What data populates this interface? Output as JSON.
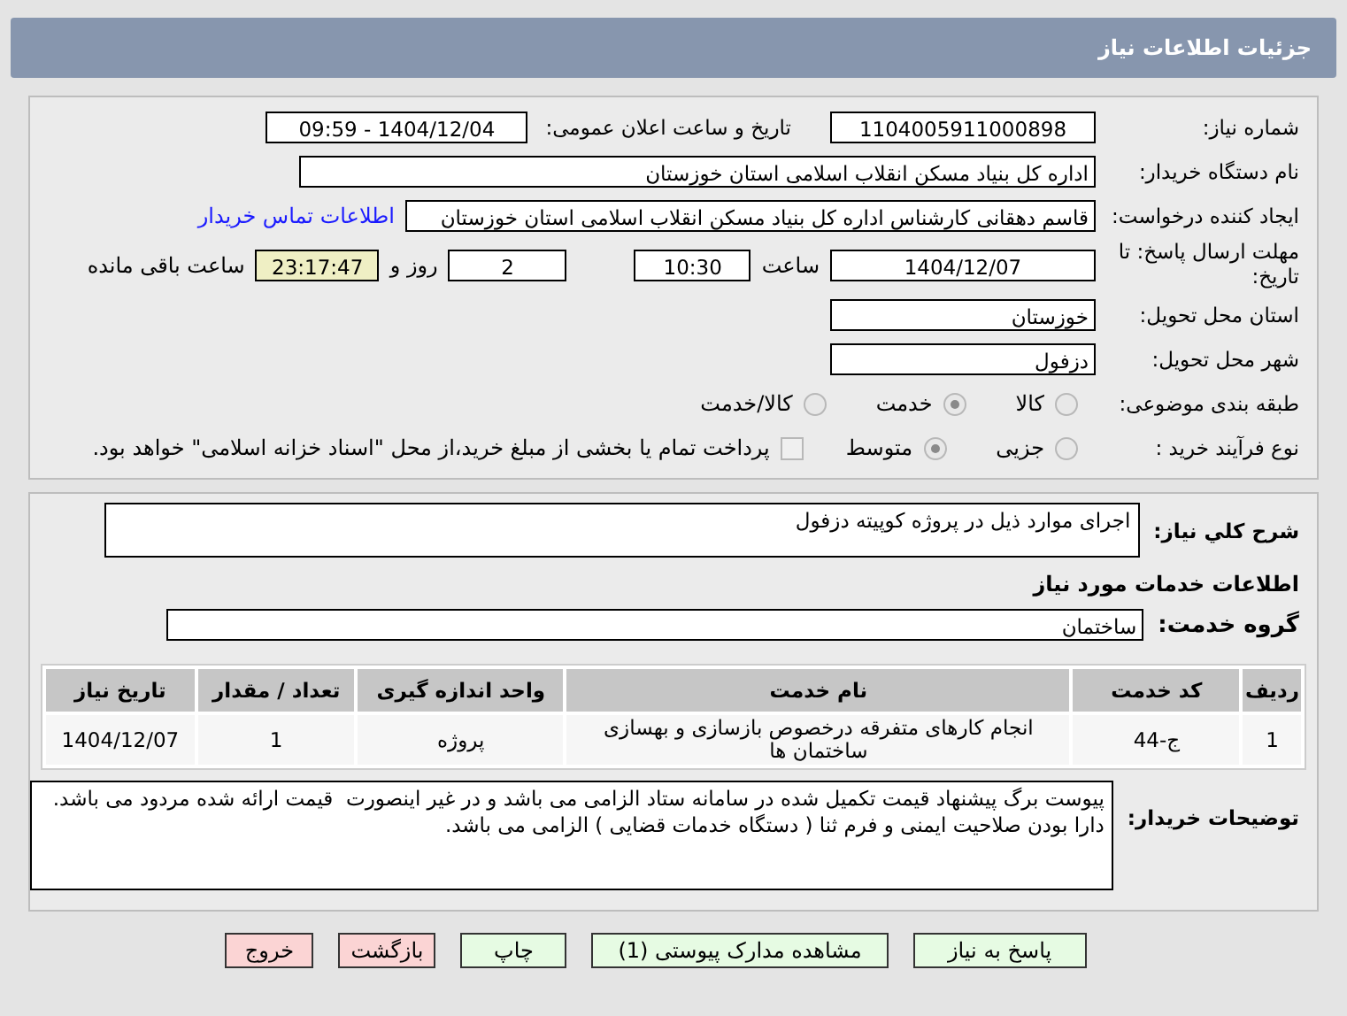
{
  "header": {
    "title": "جزئیات اطلاعات نیاز"
  },
  "need_number": {
    "label": "شماره نیاز:",
    "value": "1104005911000898"
  },
  "announce_date": {
    "label": "تاریخ و ساعت اعلان عمومی:",
    "value": "1404/12/04 - 09:59"
  },
  "buyer_org": {
    "label": "نام دستگاه خریدار:",
    "value": "اداره کل بنیاد مسکن انقلاب اسلامی استان خوزستان"
  },
  "requester": {
    "label": "ایجاد کننده درخواست:",
    "value": "قاسم دهقانی کارشناس اداره کل بنیاد مسکن انقلاب اسلامی استان خوزستان",
    "link": "اطلاعات تماس خریدار"
  },
  "deadline": {
    "label": "مهلت ارسال پاسخ: تا تاریخ:",
    "date": "1404/12/07",
    "time_label": "ساعت",
    "time": "10:30",
    "days": "2",
    "days_label": "روز و",
    "remaining": "23:17:47",
    "remaining_label": "ساعت باقی مانده"
  },
  "province": {
    "label": "استان محل تحویل:",
    "value": "خوزستان"
  },
  "city": {
    "label": "شهر محل تحویل:",
    "value": "دزفول"
  },
  "category": {
    "label": "طبقه بندی موضوعی:",
    "options": [
      {
        "label": "کالا",
        "selected": false
      },
      {
        "label": "خدمت",
        "selected": true
      },
      {
        "label": "کالا/خدمت",
        "selected": false
      }
    ]
  },
  "purchase_type": {
    "label": "نوع فرآیند خرید :",
    "options": [
      {
        "label": "جزیی",
        "selected": false
      },
      {
        "label": "متوسط",
        "selected": true
      }
    ],
    "treasury": {
      "label": "پرداخت تمام یا بخشی از مبلغ خرید،از محل \"اسناد خزانه اسلامی\" خواهد بود.",
      "checked": false
    }
  },
  "description": {
    "label": "شرح کلي نیاز:",
    "value": "اجرای موارد ذیل در پروژه کوپیته دزفول"
  },
  "services_heading": "اطلاعات خدمات مورد نیاز",
  "service_group": {
    "label": "گروه خدمت:",
    "value": "ساختمان"
  },
  "table": {
    "columns": [
      "ردیف",
      "کد خدمت",
      "نام خدمت",
      "واحد اندازه گیری",
      "تعداد / مقدار",
      "تاریخ نیاز"
    ],
    "rows": [
      [
        "1",
        "ج-44",
        "انجام کارهای متفرقه درخصوص بازسازی و بهسازی ساختمان ها",
        "پروژه",
        "1",
        "1404/12/07"
      ]
    ]
  },
  "buyer_notes": {
    "label": "توضیحات خریدار:",
    "paragraphs": [
      "پیوست برگ پیشنهاد قیمت تکمیل شده در سامانه ستاد الزامی می باشد و در غیر اینصورت  قیمت ارائه شده مردود می باشد.",
      "دارا بودن صلاحیت ایمنی و فرم ثنا ( دستگاه خدمات قضایی ) الزامی می باشد."
    ]
  },
  "buttons": [
    {
      "label": "پاسخ به نیاز",
      "kind": "normal"
    },
    {
      "label": "مشاهده مدارک پیوستی (1)",
      "kind": "normal"
    },
    {
      "label": "چاپ",
      "kind": "normal"
    },
    {
      "label": "بازگشت",
      "kind": "danger"
    },
    {
      "label": "خروج",
      "kind": "danger"
    }
  ]
}
